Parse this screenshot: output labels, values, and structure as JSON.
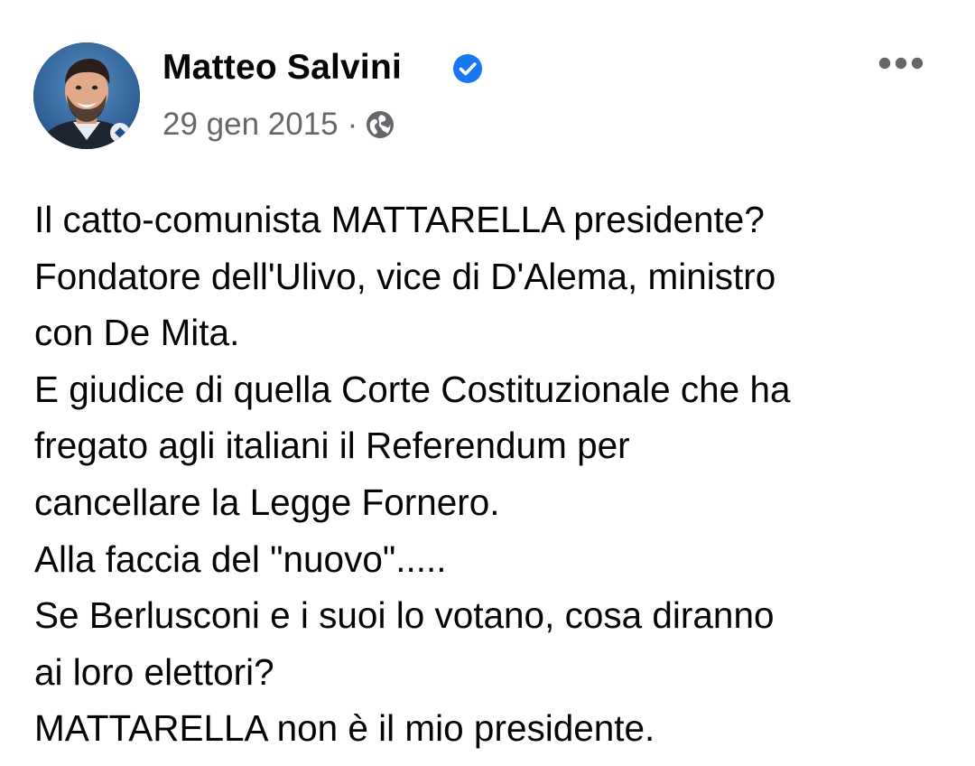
{
  "post": {
    "author": "Matteo Salvini",
    "date": "29 gen 2015",
    "separator": "·",
    "audience_icon": "globe-icon",
    "verified_icon": "verified-badge-icon",
    "more_icon": "more-options-icon",
    "accent_color": "#1877f2",
    "lines": [
      "Il catto-comunista MATTARELLA presidente?",
      "Fondatore dell'Ulivo, vice di D'Alema, ministro",
      "con De Mita.",
      "E giudice di quella Corte Costituzionale che ha",
      "fregato agli italiani il Referendum per",
      "cancellare la Legge Fornero.",
      "Alla faccia del \"nuovo\".....",
      "Se Berlusconi e i suoi lo votano, cosa diranno",
      "ai loro elettori?",
      "MATTARELLA non è il mio presidente."
    ]
  }
}
